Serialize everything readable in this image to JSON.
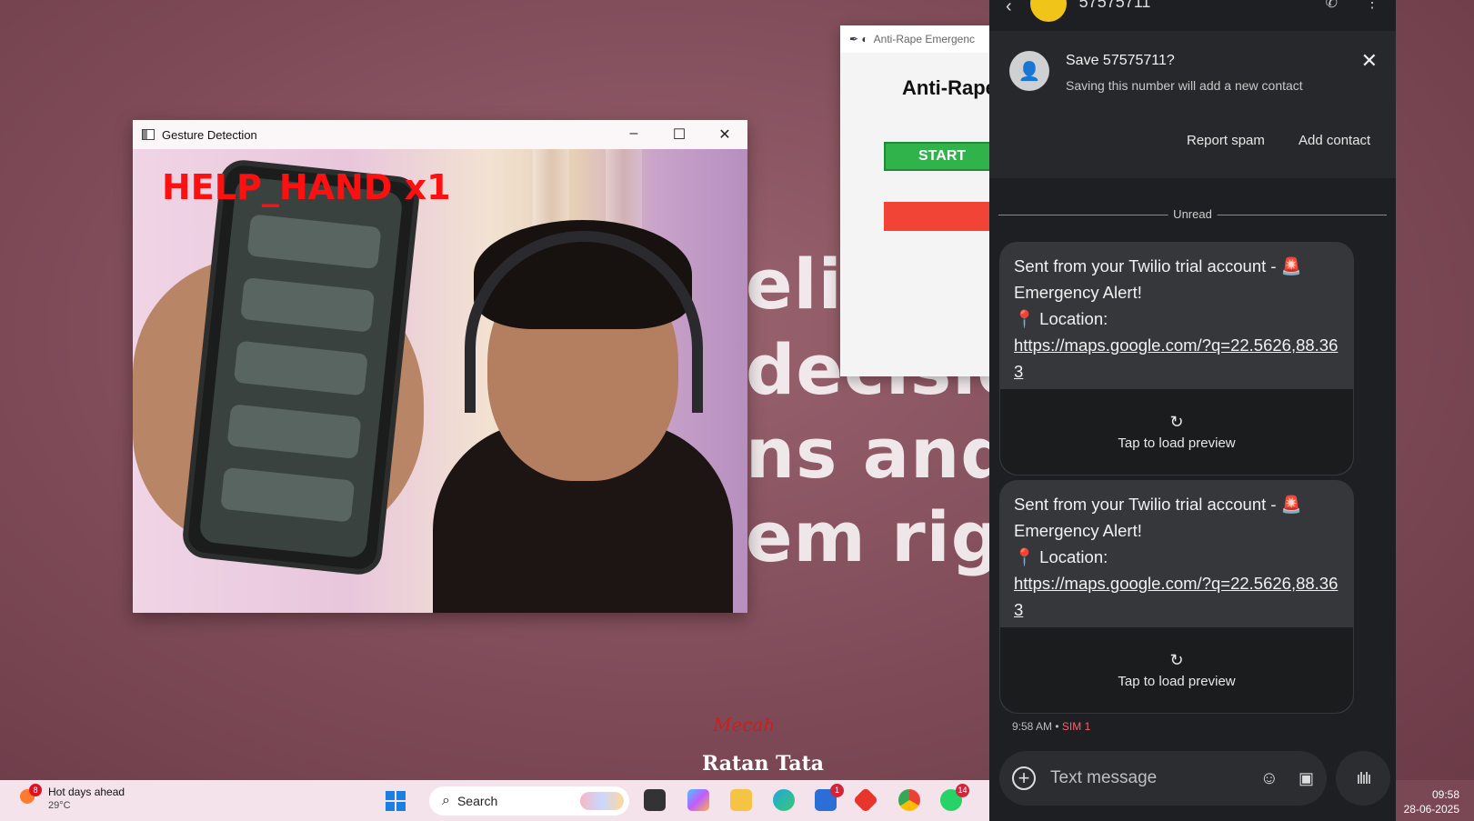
{
  "background": {
    "lines": [
      "elie",
      "decisio",
      "ns and t",
      "em right"
    ],
    "signature_small": "Mecah",
    "signature_name": "Ratan Tata"
  },
  "gesture_window": {
    "title": "Gesture Detection",
    "minimize": "–",
    "maximize": "☐",
    "close": "✕",
    "overlay_text": "HELP_HAND x1"
  },
  "anti_window": {
    "title": "Anti-Rape Emergenc",
    "heading": "Anti-Rape",
    "start_label": "START"
  },
  "messages": {
    "contact_number": "57575711",
    "save_card": {
      "title": "Save 57575711?",
      "subtitle": "Saving this number will add a new contact",
      "report_spam": "Report spam",
      "add_contact": "Add contact"
    },
    "unread_label": "Unread",
    "items": [
      {
        "line1": "Sent from your Twilio trial account - 🚨",
        "line2": "Emergency Alert!",
        "line3": "📍 Location:",
        "link": "https://maps.google.com/?q=22.5626,88.363",
        "preview": "Tap to load preview"
      },
      {
        "line1": "Sent from your Twilio trial account - 🚨",
        "line2": "Emergency Alert!",
        "line3": "📍 Location:",
        "link": "https://maps.google.com/?q=22.5626,88.363",
        "preview": "Tap to load preview"
      }
    ],
    "timestamp": "9:58 AM",
    "separator": "•",
    "sim": "SIM 1",
    "composer_placeholder": "Text message"
  },
  "taskbar": {
    "weather_title": "Hot days ahead",
    "weather_temp": "29°C",
    "weather_badge": "8",
    "search_label": "Search",
    "store_badge": "1",
    "whatsapp_badge": "14",
    "time": "09:58",
    "date": "28-06-2025"
  },
  "colors": {
    "accent_green": "#2fb34a",
    "accent_red": "#f14336",
    "sim_color": "#ff5f6d"
  }
}
